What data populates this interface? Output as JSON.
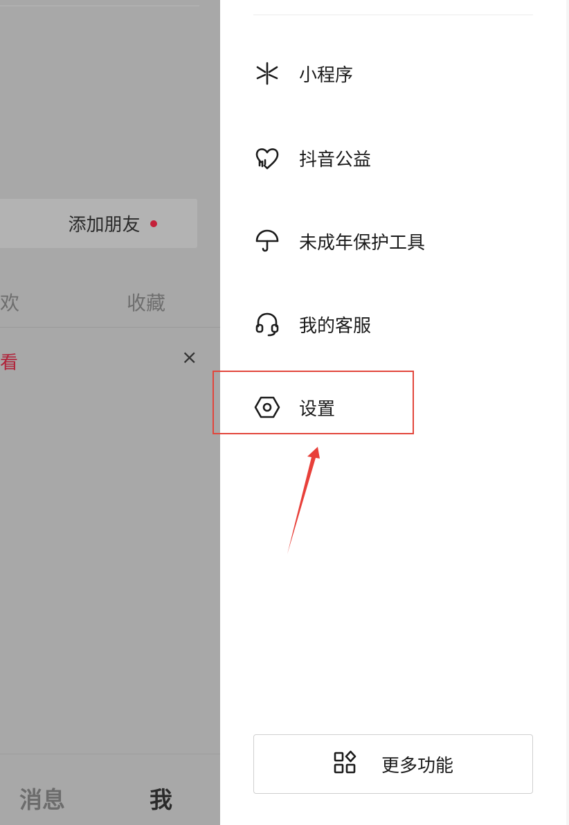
{
  "profile": {
    "add_friend_label": "添加朋友",
    "tabs": [
      "欢",
      "收藏"
    ],
    "view_link": "查看",
    "close_symbol": "×"
  },
  "bottom_nav": {
    "messages": "消息",
    "me": "我"
  },
  "drawer": {
    "menu": [
      {
        "label": "小程序",
        "icon": "mini-program-icon"
      },
      {
        "label": "抖音公益",
        "icon": "charity-heart-icon"
      },
      {
        "label": "未成年保护工具",
        "icon": "umbrella-icon"
      },
      {
        "label": "我的客服",
        "icon": "headset-icon"
      },
      {
        "label": "设置",
        "icon": "settings-icon"
      }
    ],
    "more_button": {
      "label": "更多功能",
      "icon": "apps-grid-icon"
    }
  },
  "colors": {
    "accent_red": "#e2453b",
    "dot_red": "#c4213a",
    "overlay_gray": "#a8a8a8"
  }
}
